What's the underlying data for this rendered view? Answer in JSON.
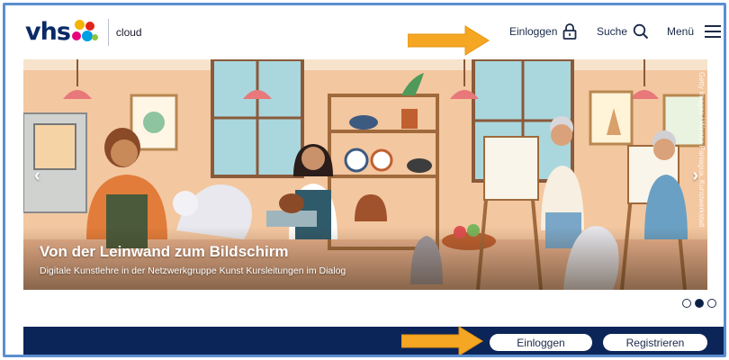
{
  "header": {
    "logo_text": "vhs",
    "product_label": "cloud",
    "login_label": "Einloggen",
    "search_label": "Suche",
    "menu_label": "Menü"
  },
  "hero": {
    "title": "Von der Leinwand zum Bildschirm",
    "subtitle": "Digitale Kunstlehre in der Netzwerkgruppe Kunst Kursleitungen im Dialog",
    "image_credit": "Getty Images / Wenne Paniagua, Kunstwerkstatt",
    "prev_glyph": "‹",
    "next_glyph": "›"
  },
  "carousel": {
    "total_slides": 3,
    "active_slide": 2
  },
  "bottom_bar": {
    "login_button": "Einloggen",
    "register_button": "Registrieren"
  },
  "colors": {
    "brand_navy": "#0c2558",
    "annotation_arrow": "#f5a623",
    "frame_border": "#5b8fd0"
  },
  "icons": [
    "lock-icon",
    "search-icon",
    "hamburger-menu-icon",
    "chevron-left-icon",
    "chevron-right-icon",
    "annotation-arrow-icon"
  ]
}
